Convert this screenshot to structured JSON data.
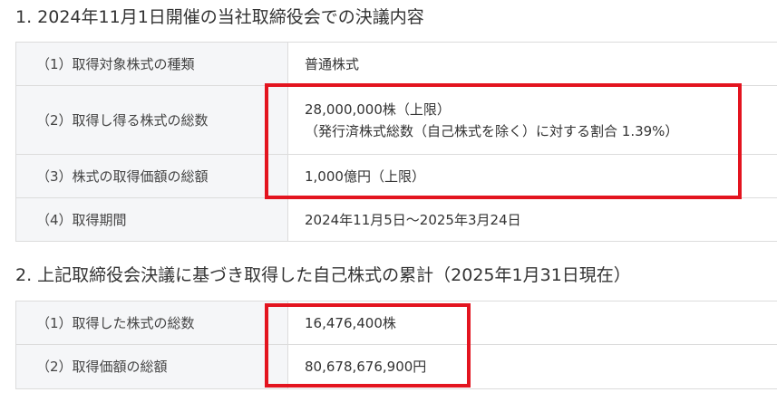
{
  "section1": {
    "title": "1. 2024年11月1日開催の当社取締役会での決議内容",
    "rows": [
      {
        "label": "（1）取得対象株式の種類",
        "value": "普通株式"
      },
      {
        "label": "（2）取得し得る株式の総数",
        "value": "28,000,000株（上限）",
        "value2": "（発行済株式総数（自己株式を除く）に対する割合 1.39%）"
      },
      {
        "label": "（3）株式の取得価額の総額",
        "value": "1,000億円（上限）"
      },
      {
        "label": "（4）取得期間",
        "value": "2024年11月5日～2025年3月24日"
      }
    ]
  },
  "section2": {
    "title": "2. 上記取締役会決議に基づき取得した自己株式の累計（2025年1月31日現在）",
    "rows": [
      {
        "label": "（1）取得した株式の総数",
        "value": "16,476,400株"
      },
      {
        "label": "（2）取得価額の総額",
        "value": "80,678,676,900円"
      }
    ]
  },
  "colors": {
    "highlight_border": "#e3141f",
    "label_background": "#f5f6f8",
    "border": "#dcdcdc"
  }
}
